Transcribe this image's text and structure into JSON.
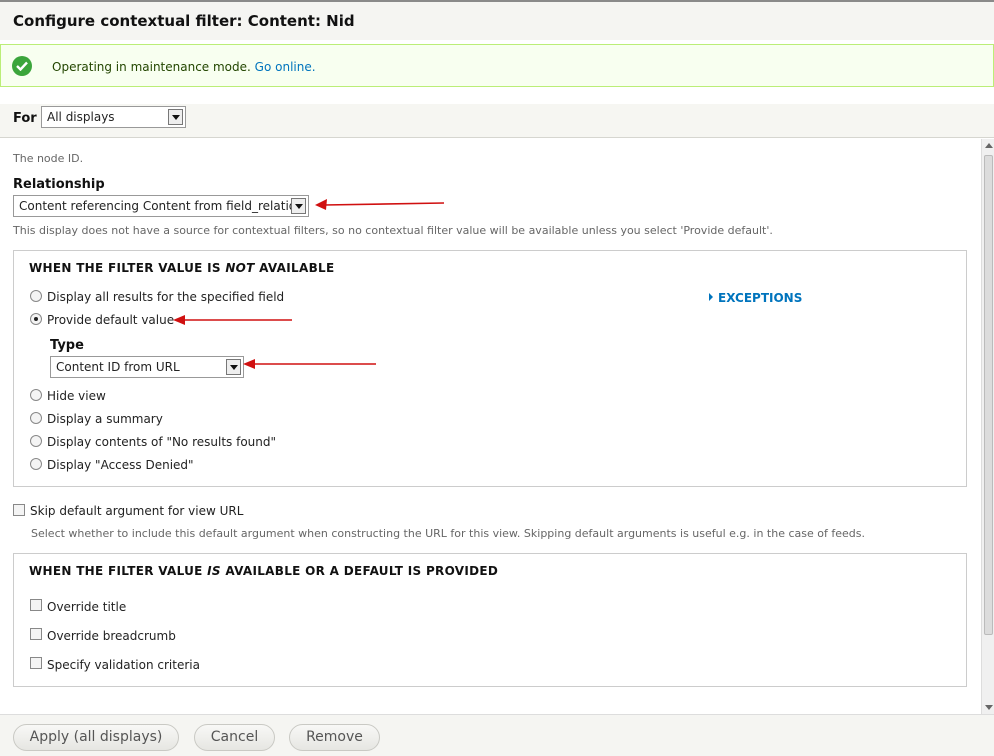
{
  "dialog": {
    "title": "Configure contextual filter: Content: Nid"
  },
  "message": {
    "text": "Operating in maintenance mode.",
    "link": "Go online."
  },
  "for_select": {
    "label": "For",
    "value": "All displays"
  },
  "form": {
    "node_desc": "The node ID.",
    "relationship": {
      "label": "Relationship",
      "value": "Content referencing Content from field_relation"
    },
    "no_source_desc": "This display does not have a source for contextual filters, so no contextual filter value will be available unless you select 'Provide default'.",
    "not_available": {
      "legend_pre": "WHEN THE FILTER VALUE IS ",
      "legend_em": "NOT",
      "legend_post": " AVAILABLE",
      "exceptions": "EXCEPTIONS",
      "options": [
        "Display all results for the specified field",
        "Provide default value",
        "Hide view",
        "Display a summary",
        "Display contents of \"No results found\"",
        "Display \"Access Denied\""
      ],
      "selected_index": 1,
      "type": {
        "label": "Type",
        "value": "Content ID from URL"
      }
    },
    "skip_default": {
      "label": "Skip default argument for view URL",
      "checked": false,
      "desc": "Select whether to include this default argument when constructing the URL for this view. Skipping default arguments is useful e.g. in the case of feeds."
    },
    "available": {
      "legend_pre": "WHEN THE FILTER VALUE ",
      "legend_em": "IS",
      "legend_post": " AVAILABLE OR A DEFAULT IS PROVIDED",
      "options": [
        "Override title",
        "Override breadcrumb",
        "Specify validation criteria"
      ]
    }
  },
  "buttons": {
    "apply": "Apply (all displays)",
    "cancel": "Cancel",
    "remove": "Remove"
  },
  "colors": {
    "link": "#0074bd",
    "annotation_arrow": "#d01010",
    "success": "#3ba53b"
  },
  "icons": [
    "check-circle-icon",
    "chevron-down-icon",
    "triangle-right-icon",
    "red-arrow-annotation"
  ]
}
